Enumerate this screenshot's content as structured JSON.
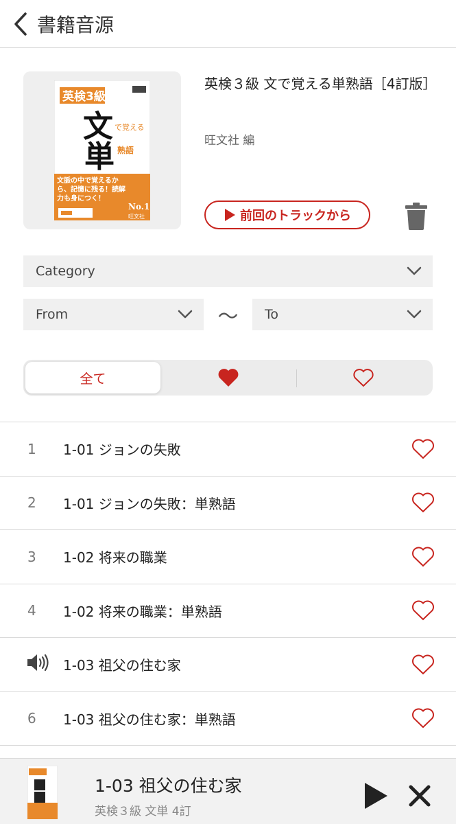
{
  "header": {
    "title": "書籍音源",
    "back_icon": "chevron-left-icon"
  },
  "book": {
    "title": "英検３級 文で覚える単熟語［4訂版］",
    "author": "旺文社 編",
    "cover": {
      "top_label": "英検3級",
      "big1": "文",
      "big2": "単",
      "side1": "で覚える",
      "side2": "熟語",
      "blurb": "文脈の中で覚えるから、記憶に残る！読解力も身につく！",
      "badge": "No.1",
      "publisher": "旺文社"
    },
    "resume_label": "前回のトラックから"
  },
  "filters": {
    "category": "Category",
    "from": "From",
    "to": "To",
    "tilde": "～"
  },
  "segment": {
    "all_label": "全て"
  },
  "tracks": [
    {
      "num": "1",
      "title": "1-01 ジョンの失敗",
      "playing": false
    },
    {
      "num": "2",
      "title": "1-01 ジョンの失敗：単熟語",
      "playing": false
    },
    {
      "num": "3",
      "title": "1-02 将来の職業",
      "playing": false
    },
    {
      "num": "4",
      "title": "1-02 将来の職業：単熟語",
      "playing": false
    },
    {
      "num": "",
      "title": "1-03 祖父の住む家",
      "playing": true
    },
    {
      "num": "6",
      "title": "1-03 祖父の住む家：単熟語",
      "playing": false
    }
  ],
  "player": {
    "title": "1-03 祖父の住む家",
    "subtitle": "英検３級 文単 4訂"
  },
  "colors": {
    "accent": "#c8251f",
    "cover_orange": "#e8892b"
  }
}
